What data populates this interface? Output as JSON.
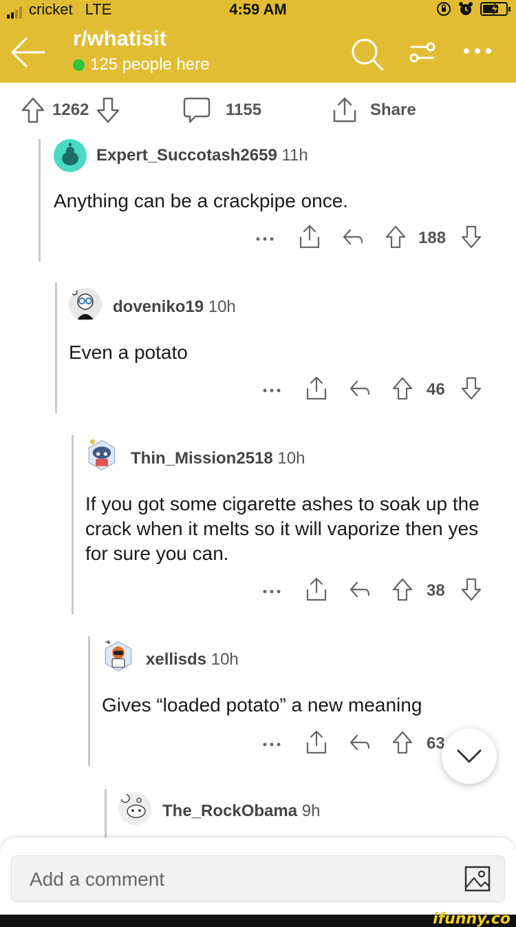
{
  "status_bar": {
    "carrier": "cricket",
    "network": "LTE",
    "time": "4:59 AM",
    "signal_bars": 2,
    "battery_level": 0.7
  },
  "header": {
    "subreddit": "r/whatisit",
    "online_count": "125 people here",
    "icons": [
      "back-arrow-icon",
      "search-icon",
      "filter-icon",
      "more-icon"
    ],
    "color": "#e2bd34"
  },
  "post_bar": {
    "score": "1262",
    "comment_count": "1155",
    "share_label": "Share"
  },
  "comments": [
    {
      "author": "Expert_Succotash2659",
      "age": "11h",
      "text": "Anything can be a crackpipe once.",
      "score": "188"
    },
    {
      "author": "doveniko19",
      "age": "10h",
      "text": "Even a potato",
      "score": "46"
    },
    {
      "author": "Thin_Mission2518",
      "age": "10h",
      "text": "If you got some cigarette ashes to soak up the crack when it melts so it will vaporize then yes for sure you can.",
      "score": "38"
    },
    {
      "author": "xellisds",
      "age": "10h",
      "text": "Gives “loaded potato” a new meaning",
      "score": "63"
    },
    {
      "author": "The_RockObama",
      "age": "9h",
      "text": "",
      "score": ""
    }
  ],
  "composer": {
    "placeholder": "Add a comment"
  },
  "watermark": "ifunny.co"
}
